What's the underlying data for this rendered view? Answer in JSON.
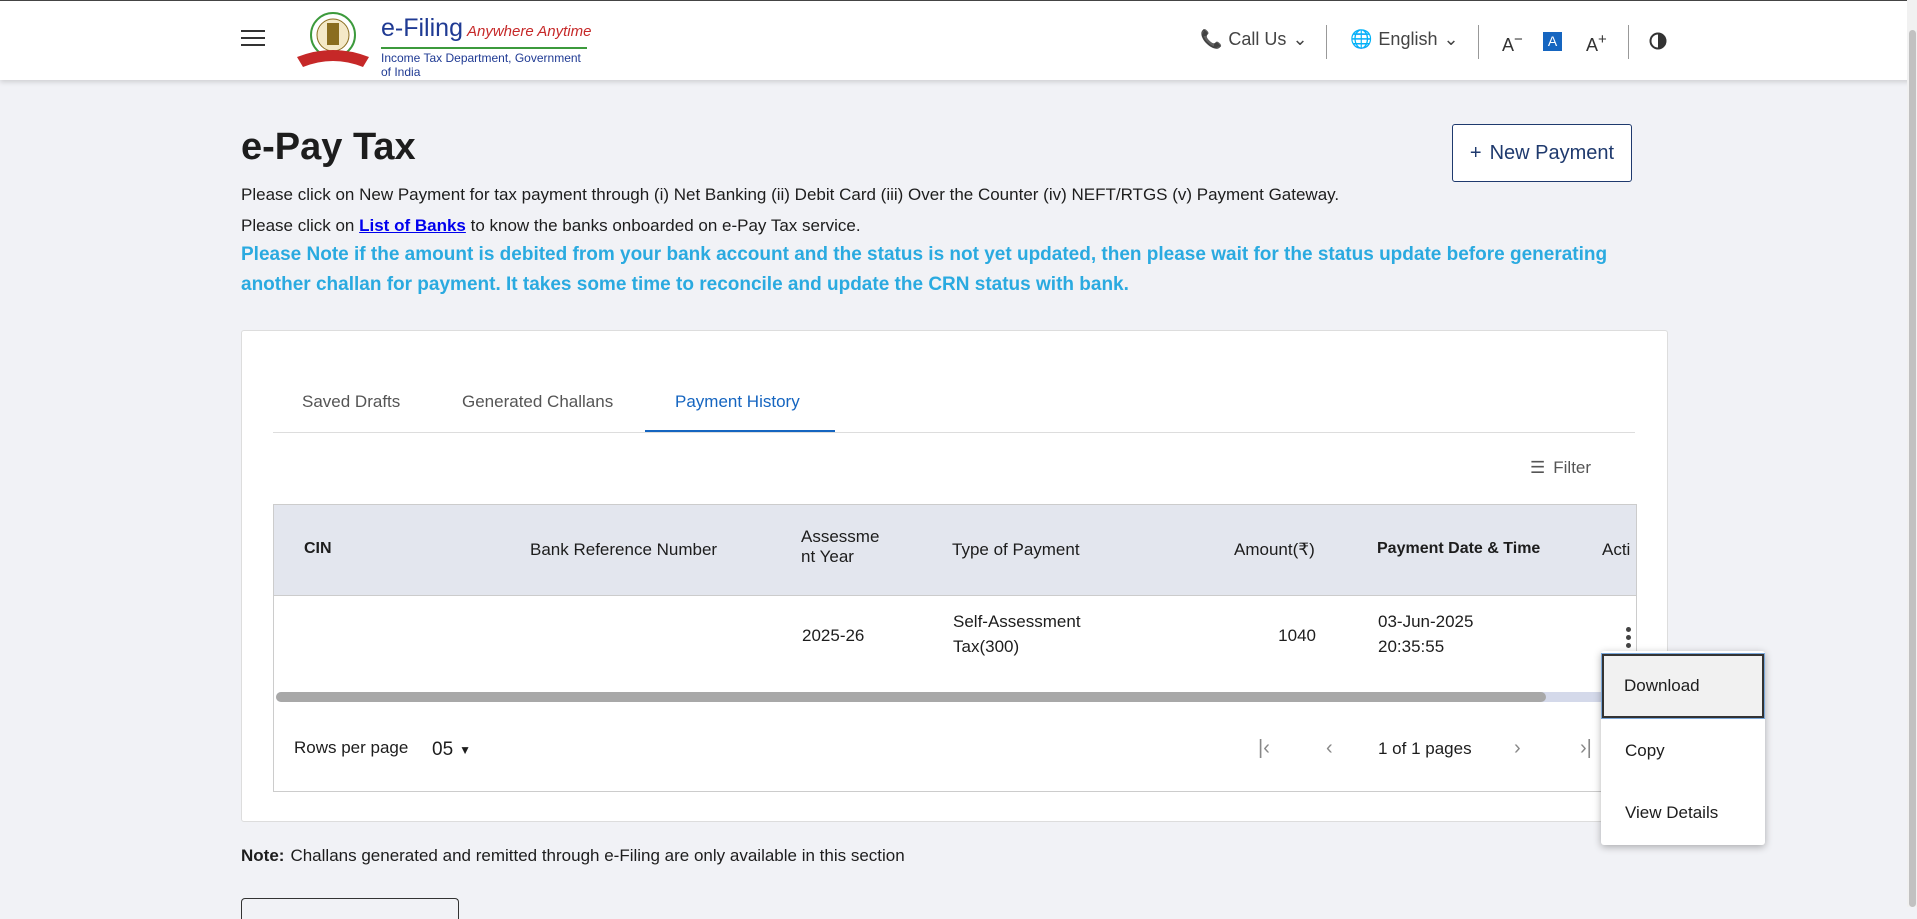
{
  "header": {
    "logo_title": "e-Filing",
    "logo_tagline": "Anywhere Anytime",
    "logo_subtitle": "Income Tax Department, Government of India",
    "call_us": "Call Us",
    "language": "English",
    "font_decrease": "A",
    "font_default": "A",
    "font_increase": "A"
  },
  "page": {
    "title": "e-Pay Tax",
    "new_payment": "New Payment",
    "line1": "Please click on New Payment for tax payment through (i) Net Banking (ii) Debit Card (iii) Over the Counter (iv) NEFT/RTGS (v) Payment Gateway.",
    "line2_prefix": "Please click on ",
    "line2_link": "List of Banks",
    "line2_suffix": " to know the banks onboarded on e-Pay Tax service.",
    "notice": "Please Note if the amount is debited from your bank account and the status is not yet updated, then please wait for the status update before generating another challan for payment. It takes some time to reconcile and update the CRN status with bank."
  },
  "tabs": [
    "Saved Drafts",
    "Generated Challans",
    "Payment History"
  ],
  "active_tab": "Payment History",
  "filter_label": "Filter",
  "table": {
    "headers": {
      "cin": "CIN",
      "bank_ref": "Bank Reference Number",
      "ay_line1": "Assessme",
      "ay_line2": "nt Year",
      "type": "Type of Payment",
      "amount": "Amount(₹)",
      "date": "Payment Date & Time",
      "action": "Acti"
    },
    "row": {
      "cin": "",
      "bank_ref": "",
      "ay": "2025-26",
      "type_line1": "Self-Assessment",
      "type_line2": "Tax(300)",
      "amount": "1040",
      "date_line1": "03-Jun-2025",
      "date_line2": "20:35:55"
    },
    "rows_per_page_label": "Rows per page",
    "rows_per_page": "05",
    "pager_text": "1 of 1 pages"
  },
  "menu": [
    "Download",
    "Copy",
    "View Details"
  ],
  "note_label": "Note:",
  "note_text": "Challans generated and remitted through e-Filing are only available in this section",
  "colors": {
    "accent": "#1565c0",
    "notice": "#2aaae0",
    "primary_button_border": "#1f3a6e"
  }
}
